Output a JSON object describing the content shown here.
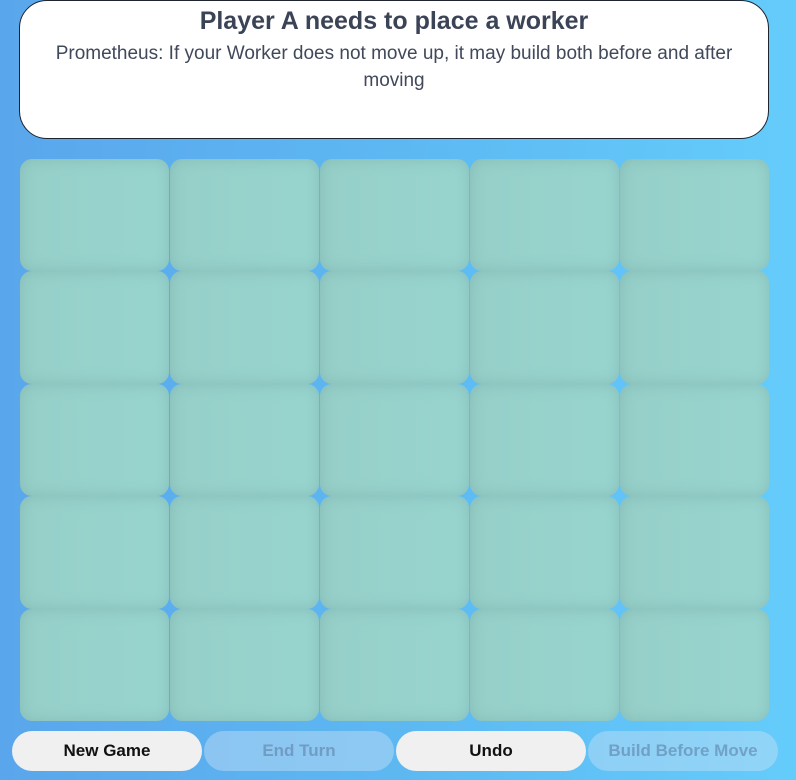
{
  "header": {
    "title": "Player A needs to place a worker",
    "description": "Prometheus: If your Worker does not move up, it may build both before and after moving"
  },
  "board": {
    "rows": 5,
    "cols": 5,
    "cells": [
      [
        "",
        "",
        "",
        "",
        ""
      ],
      [
        "",
        "",
        "",
        "",
        ""
      ],
      [
        "",
        "",
        "",
        "",
        ""
      ],
      [
        "",
        "",
        "",
        "",
        ""
      ],
      [
        "",
        "",
        "",
        "",
        ""
      ]
    ]
  },
  "controls": {
    "new_game": "New Game",
    "end_turn": "End Turn",
    "undo": "Undo",
    "build_before_move": "Build Before Move"
  },
  "colors": {
    "tile": "#96cfc8",
    "background_left": "#5aa6ec",
    "background_right": "#64ccfb"
  }
}
